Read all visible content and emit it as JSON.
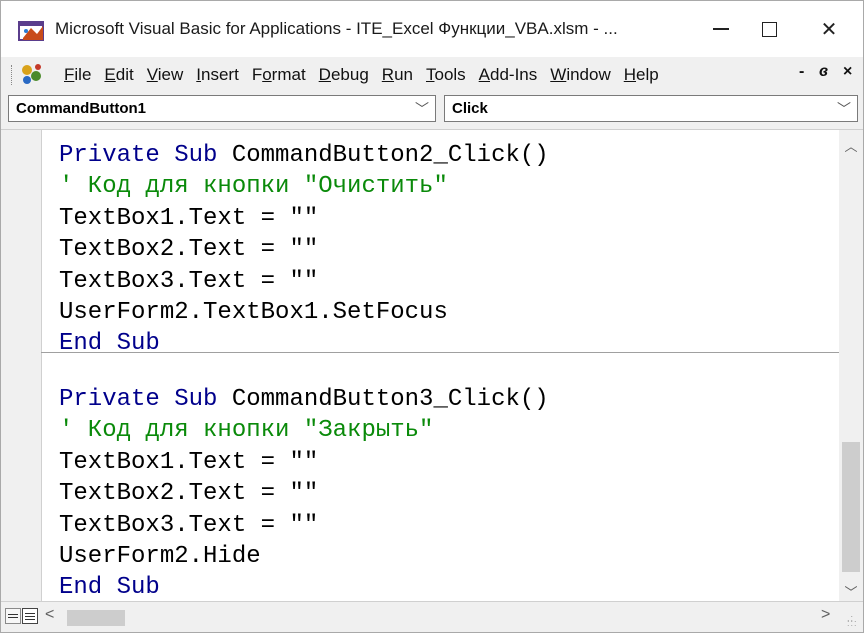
{
  "window": {
    "title": "Microsoft Visual Basic for Applications - ITE_Excel Функции_VBA.xlsm - ...",
    "minimize_label": "—",
    "close_label": "✕"
  },
  "menu": {
    "items": [
      "File",
      "Edit",
      "View",
      "Insert",
      "Format",
      "Debug",
      "Run",
      "Tools",
      "Add-Ins",
      "Window",
      "Help"
    ],
    "mnemonics": [
      "F",
      "E",
      "V",
      "I",
      "o",
      "D",
      "R",
      "T",
      "A",
      "W",
      "H"
    ],
    "right_controls": [
      "-",
      "ɞ",
      "×"
    ]
  },
  "combos": {
    "object": "CommandButton1",
    "procedure": "Click"
  },
  "code": {
    "proc1": [
      [
        {
          "t": "kw",
          "v": "Private Sub "
        },
        {
          "t": "tx",
          "v": "CommandButton2_Click()"
        }
      ],
      [
        {
          "t": "cm",
          "v": "' Код для кнопки \"Очистить\""
        }
      ],
      [
        {
          "t": "tx",
          "v": "TextBox1.Text = \"\""
        }
      ],
      [
        {
          "t": "tx",
          "v": "TextBox2.Text = \"\""
        }
      ],
      [
        {
          "t": "tx",
          "v": "TextBox3.Text = \"\""
        }
      ],
      [
        {
          "t": "tx",
          "v": "UserForm2.TextBox1.SetFocus"
        }
      ],
      [
        {
          "t": "kw",
          "v": "End Sub"
        }
      ]
    ],
    "proc2": [
      [
        {
          "t": "kw",
          "v": "Private Sub "
        },
        {
          "t": "tx",
          "v": "CommandButton3_Click()"
        }
      ],
      [
        {
          "t": "cm",
          "v": "' Код для кнопки \"Закрыть\""
        }
      ],
      [
        {
          "t": "tx",
          "v": "TextBox1.Text = \"\""
        }
      ],
      [
        {
          "t": "tx",
          "v": "TextBox2.Text = \"\""
        }
      ],
      [
        {
          "t": "tx",
          "v": "TextBox3.Text = \"\""
        }
      ],
      [
        {
          "t": "tx",
          "v": "UserForm2.Hide"
        }
      ],
      [
        {
          "t": "kw",
          "v": "End Sub"
        }
      ]
    ]
  },
  "colors": {
    "keyword": "#00008b",
    "comment": "#0a8a0a",
    "text": "#000000"
  },
  "icons": {
    "app": "vba-editor-icon",
    "menu": "vba-project-icon",
    "scroll_up": "chevron-up-icon",
    "scroll_down": "chevron-down-icon",
    "scroll_left": "chevron-left-icon",
    "scroll_right": "chevron-right-icon"
  }
}
